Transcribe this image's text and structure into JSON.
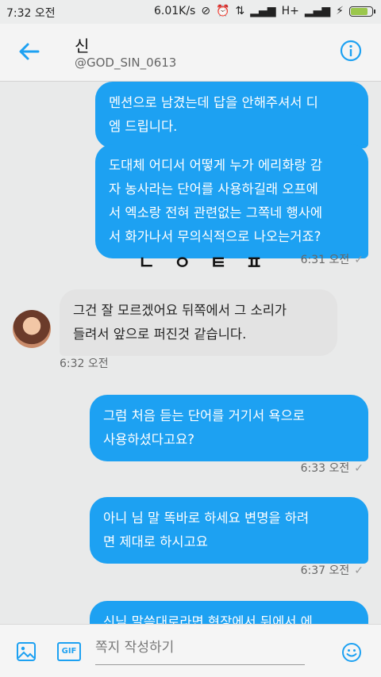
{
  "status": {
    "time": "7:32 오전",
    "speed": "6.01K/s",
    "network": "H+",
    "battery_level": 0.88
  },
  "header": {
    "name": "신",
    "handle": "@GOD_SIN_0613"
  },
  "overlay_text": "ㄴ ㅇ ㅌ ㅍ",
  "messages": [
    {
      "dir": "out",
      "text": "멘션으로 남겼는데 답을 안해주셔서 디\n엠 드립니다."
    },
    {
      "dir": "out",
      "text": "도대체 어디서 어떻게 누가 에리화랑 감\n자 농사라는 단어를 사용하길래 오프에\n서 엑소랑 전혀 관련없는 그쪽네 행사에\n서 화가나서 무의식적으로 나오는거죠?",
      "time": "6:31 오전"
    },
    {
      "dir": "in",
      "text": "그건 잘 모르겠어요 뒤쪽에서 그 소리가\n들려서 앞으로 퍼진것 같습니다.",
      "time": "6:32 오전"
    },
    {
      "dir": "out",
      "text": "그럼 처음 듣는 단어를 거기서 욕으로\n사용하셨다고요?",
      "time": "6:33 오전"
    },
    {
      "dir": "out",
      "text": "아니 님 말 똑바로 하세요 변명을 하려\n면 제대로 하시고요",
      "time": "6:37 오전"
    },
    {
      "dir": "out",
      "text": "신님 말씀대로라면 현장에서 뒤에서 에"
    }
  ],
  "composer": {
    "placeholder": "쪽지 작성하기",
    "gif_label": "GIF"
  },
  "colors": {
    "accent": "#1da1f2"
  }
}
